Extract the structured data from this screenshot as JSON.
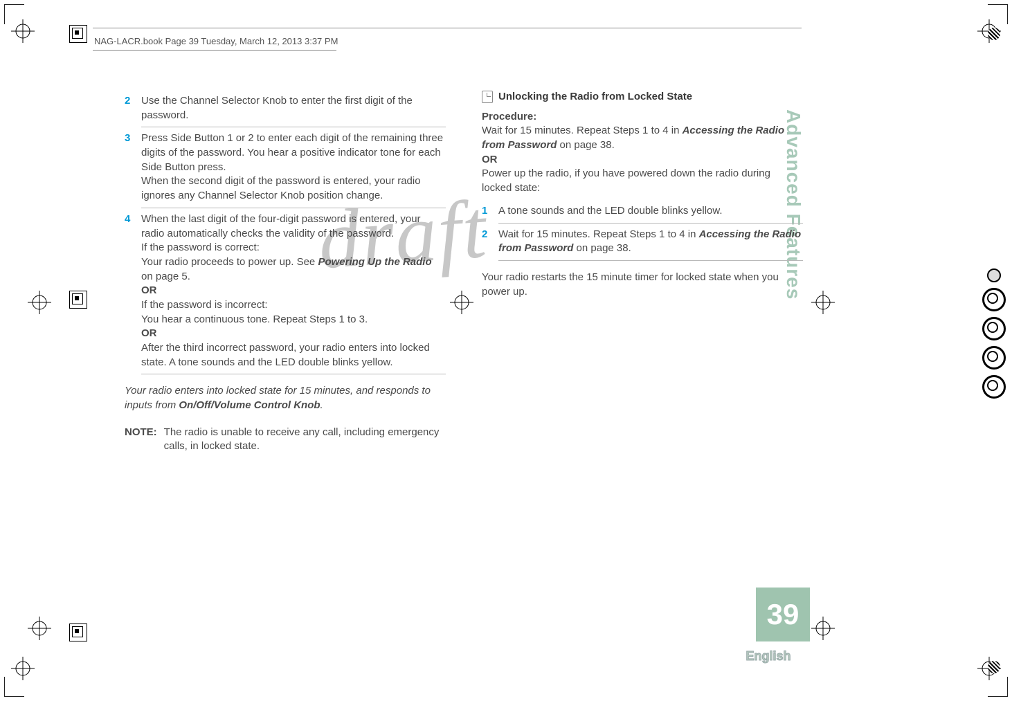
{
  "header": {
    "running_head": "NAG-LACR.book  Page 39  Tuesday, March 12, 2013  3:37 PM"
  },
  "watermark": "draft",
  "side": {
    "section_title": "Advanced Features",
    "page_number": "39",
    "language": "English"
  },
  "left_column": {
    "step2_num": "2",
    "step2_text": "Use the Channel Selector Knob to enter the first digit of the password.",
    "step3_num": "3",
    "step3_text": "Press Side Button 1 or 2 to enter each digit of the remaining three digits of the password. You hear a positive indicator tone for each Side Button press.\nWhen the second digit of the password is entered, your radio ignores any Channel Selector Knob position change.",
    "step4_num": "4",
    "step4_a": "When the last digit of the four-digit password is entered, your radio automatically checks the validity of the password.\nIf the password is correct:",
    "step4_see_prefix": "Your radio proceeds to power up. See ",
    "step4_see_link": "Powering Up the Radio",
    "step4_see_suffix": " on page 5.",
    "or1": "OR",
    "step4_incorrect_label": "If the password is incorrect:",
    "step4_incorrect_text": "You hear a continuous tone. Repeat Steps 1 to 3.",
    "or2": "OR",
    "step4_lock_text": "After the third incorrect password, your radio enters into locked state. A tone sounds and the LED double blinks yellow.",
    "locked_note_italic": "Your radio enters into locked state for 15 minutes, and responds to inputs from ",
    "locked_note_knob": "On/Off/Volume Control Knob",
    "locked_note_period": ".",
    "note_label": "NOTE:",
    "note_text": "The radio is unable to receive any call, including emergency calls, in locked state."
  },
  "right_column": {
    "heading": "Unlocking the Radio from Locked State",
    "procedure_label": "Procedure:",
    "proc_prefix": "Wait for 15 minutes. Repeat Steps 1 to 4 in ",
    "proc_link": "Accessing the Radio from Password",
    "proc_suffix": " on page 38.",
    "or1": "OR",
    "powerup_text": "Power up the radio, if you have powered down the radio during locked state:",
    "step1_num": "1",
    "step1_text": "A tone sounds and the LED double blinks yellow.",
    "step2_num": "2",
    "step2_prefix": "Wait for 15 minutes. Repeat Steps 1 to 4 in ",
    "step2_link": "Accessing the Radio from Password",
    "step2_suffix": " on page 38.",
    "footer_text": "Your radio restarts the 15 minute timer for locked state when you power up."
  }
}
